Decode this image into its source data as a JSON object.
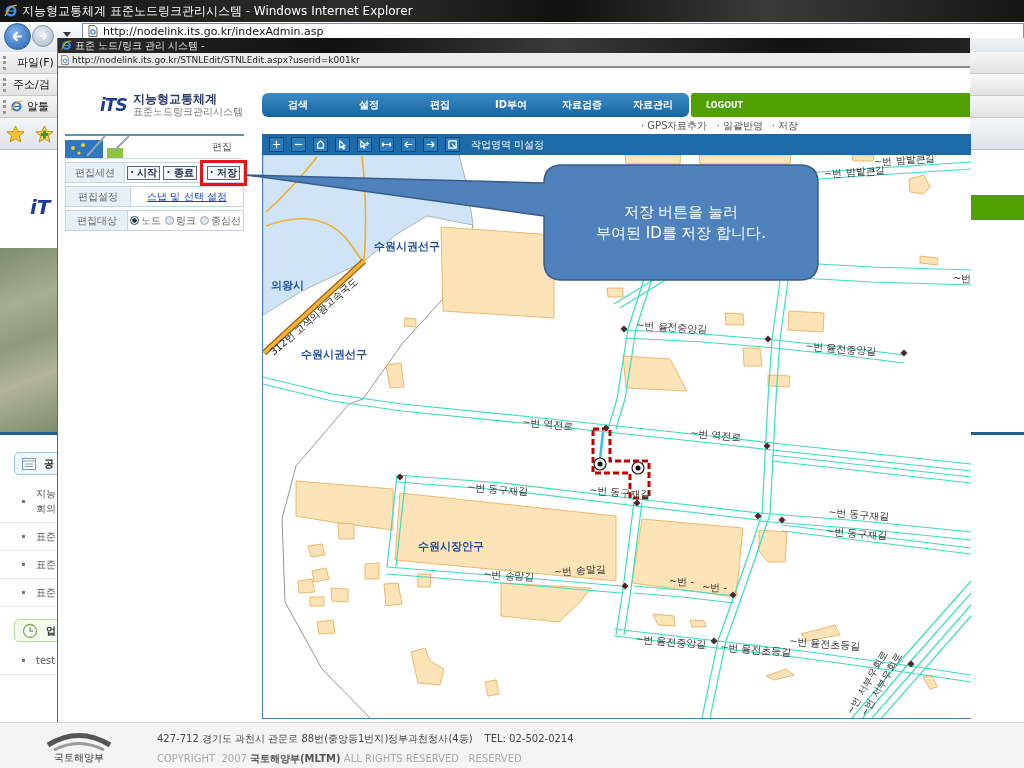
{
  "browser": {
    "title": "지능형교통체계 표준노드링크관리시스템 - Windows Internet Explorer",
    "address": "http://nodelink.its.go.kr/indexAdmin.asp",
    "toolbars": [
      {
        "kind": "menu",
        "label": "파일(F)"
      },
      {
        "kind": "search",
        "label": "주소/검"
      },
      {
        "kind": "links",
        "label": "알툴"
      }
    ]
  },
  "background_page": {
    "logo": "iT",
    "notices_heading": "공",
    "notices": [
      "지능\n회의",
      "표준",
      "표준",
      "표준"
    ],
    "updates_heading": "업",
    "updates": [
      "test"
    ]
  },
  "popup": {
    "title": "표준 노드/링크 관리 시스템 -",
    "address": "http://nodelink.its.go.kr/STNLEdit/STNLEdit.aspx?userid=k001kr",
    "logo": {
      "mark": "iTS",
      "title": "지능형교통체계",
      "subtitle": "표준노드링크관리시스템"
    },
    "nav": [
      "검색",
      "설정",
      "편집",
      "ID부여",
      "자료검증",
      "자료관리"
    ],
    "logout": "LOGOUT",
    "sub_links": [
      "· GPS자료추가",
      "· 일괄반영",
      "· 저장"
    ],
    "panel": {
      "heading": "편집",
      "rows": [
        {
          "label": "편집세션",
          "kind": "buttons",
          "buttons": [
            {
              "label": "· 시작",
              "highlighted": false
            },
            {
              "label": "· 종료",
              "highlighted": false
            },
            {
              "label": "· 저장",
              "highlighted": true
            }
          ]
        },
        {
          "label": "편집설정",
          "kind": "link",
          "link": "스냅 및 선택 설정"
        },
        {
          "label": "편집대상",
          "kind": "radios",
          "options": [
            {
              "label": "노드",
              "selected": true
            },
            {
              "label": "링크",
              "selected": false
            },
            {
              "label": "중심선",
              "selected": false
            }
          ]
        }
      ]
    },
    "map": {
      "toolbar_status": "작업영역 미설정",
      "labels": [
        {
          "kind": "road",
          "text": "~번 밤밭큰길"
        },
        {
          "kind": "road",
          "text": "~번 밤밭큰길"
        },
        {
          "kind": "district",
          "text": "수원시권선구"
        },
        {
          "kind": "district",
          "text": "의왕시"
        },
        {
          "kind": "highway",
          "text": "312번 고색의왕고속국도"
        },
        {
          "kind": "road",
          "text": "~번"
        },
        {
          "kind": "road",
          "text": "~번 율전중앙길"
        },
        {
          "kind": "road",
          "text": "~번 율전중앙길"
        },
        {
          "kind": "district",
          "text": "수원시권선구"
        },
        {
          "kind": "road",
          "text": "~번 역전로"
        },
        {
          "kind": "road",
          "text": "~번 역전로"
        },
        {
          "kind": "road",
          "text": "~번 동구재길"
        },
        {
          "kind": "road",
          "text": "~번 동구재길"
        },
        {
          "kind": "road",
          "text": "~번 동구재길"
        },
        {
          "kind": "road",
          "text": "~번 동구재길"
        },
        {
          "kind": "district",
          "text": "수원시장안구"
        },
        {
          "kind": "road",
          "text": "~번 송말길"
        },
        {
          "kind": "road",
          "text": "~번 송말길"
        },
        {
          "kind": "road",
          "text": "~번 -"
        },
        {
          "kind": "road",
          "text": "~번 -"
        },
        {
          "kind": "road",
          "text": "~번 율전중앙길"
        },
        {
          "kind": "road",
          "text": "~번 율전초등길"
        },
        {
          "kind": "road",
          "text": "~번 율전초등길"
        },
        {
          "kind": "road",
          "text": "~번 서부우회로"
        },
        {
          "kind": "road",
          "text": "~번 서부우회로"
        }
      ]
    },
    "callout": {
      "lines": [
        "저장 버튼을 눌러",
        "부여된 ID를 저장 합니다."
      ]
    }
  },
  "footer": {
    "ministry": "국토해양부",
    "address": "427-712 경기도 과천시 관문로 88번(중앙동1번지)정부과천청사(4동)",
    "tel": "TEL: 02-502-0214",
    "copyright": "COPYRIGHT  2007 **국토해양부(MLTM)** ALL RIGHTS RESERVED   RESERVED"
  }
}
